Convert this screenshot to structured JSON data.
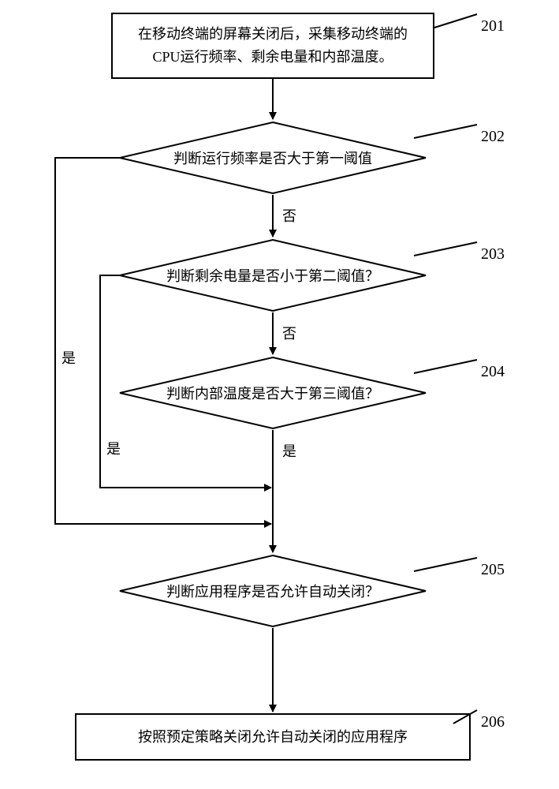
{
  "steps": {
    "s201": {
      "ref": "201",
      "text": "在移动终端的屏幕关闭后，采集移动终端的CPU运行频率、剩余电量和内部温度。"
    },
    "s202": {
      "ref": "202",
      "text": "判断运行频率是否大于第一阈值"
    },
    "s203": {
      "ref": "203",
      "text": "判断剩余电量是否小于第二阈值？"
    },
    "s204": {
      "ref": "204",
      "text": "判断内部温度是否大于第三阈值？"
    },
    "s205": {
      "ref": "205",
      "text": "判断应用程序是否允许自动关闭？"
    },
    "s206": {
      "ref": "206",
      "text": "按照预定策略关闭允许自动关闭的应用程序"
    }
  },
  "labels": {
    "yes": "是",
    "no": "否"
  }
}
